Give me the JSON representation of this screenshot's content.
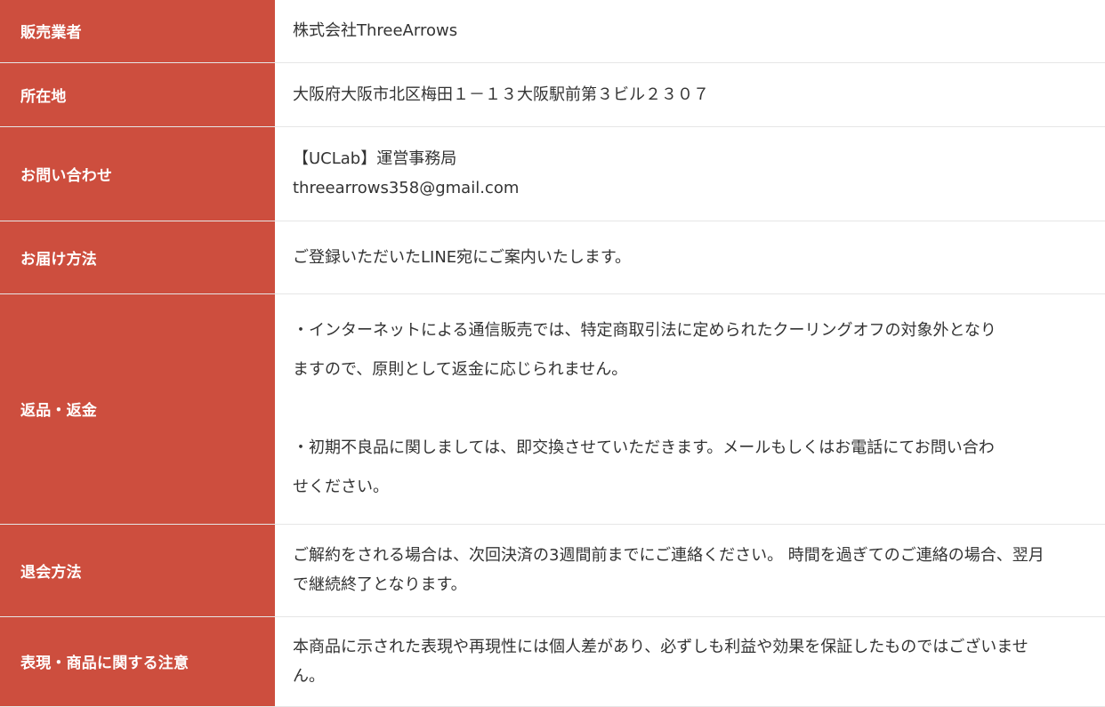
{
  "rows": [
    {
      "label": "販売業者",
      "lines": [
        "株式会社ThreeArrows"
      ]
    },
    {
      "label": "所在地",
      "lines": [
        "大阪府大阪市北区梅田１－１３大阪駅前第３ビル２３０７"
      ]
    },
    {
      "label": "お問い合わせ",
      "lines": [
        "【UCLab】運営事務局",
        "threearrows358@gmail.com"
      ]
    },
    {
      "label": "お届け方法",
      "lines": [
        "ご登録いただいたLINE宛にご案内いたします。"
      ]
    },
    {
      "label": "返品・返金",
      "lines": [
        "・インターネットによる通信販売では、特定商取引法に定められたクーリングオフの対象外となり",
        "ますので、原則として返金に応じられません。",
        "・初期不良品に関しましては、即交換させていただきます。メールもしくはお電話にてお問い合わ",
        "せください。"
      ]
    },
    {
      "label": "退会方法",
      "lines": [
        "ご解約をされる場合は、次回決済の3週間前までにご連絡ください。 時間を過ぎてのご連絡の場合、翌月",
        "で継続終了となります。"
      ]
    },
    {
      "label": "表現・商品に関する注意",
      "lines": [
        "本商品に示された表現や再現性には個人差があり、必ずしも利益や効果を保証したものではございませ",
        "ん。"
      ]
    }
  ]
}
